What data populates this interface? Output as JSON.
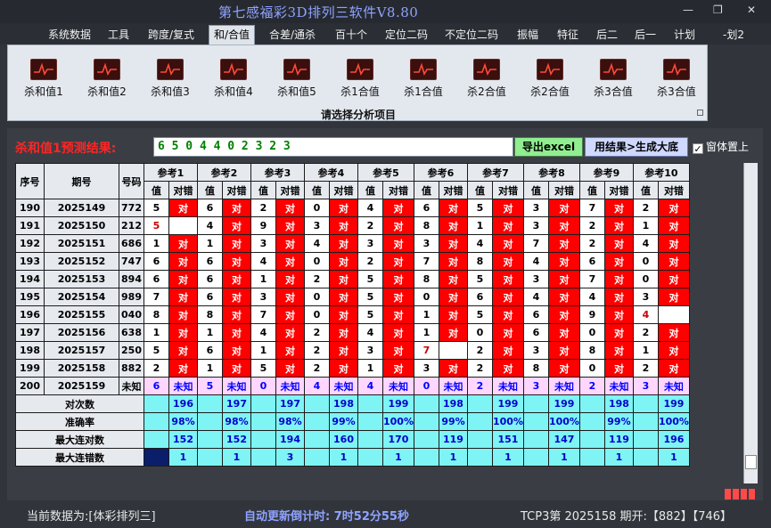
{
  "window": {
    "title": "第七感福彩3D排列三软件V8.80",
    "min_glyph": "—",
    "max_glyph": "❐",
    "close_glyph": "✕"
  },
  "menu": [
    "系统数据",
    "工具",
    "跨度/复式",
    "和/合值",
    "合差/通杀",
    "百十个",
    "定位二码",
    "不定位二码",
    "振幅",
    "特征",
    "后二",
    "后一",
    "计划",
    "-划2"
  ],
  "menu_active_index": 3,
  "toolbar": {
    "buttons": [
      "杀和值1",
      "杀和值2",
      "杀和值3",
      "杀和值4",
      "杀和值5",
      "杀1合值",
      "杀1合值",
      "杀2合值",
      "杀2合值",
      "杀3合值",
      "杀3合值"
    ],
    "group_caption": "请选择分析项目"
  },
  "result": {
    "label": "杀和值1预测结果:",
    "value": "6 5 0 4 4 0 2 3 2 3",
    "excel_button": "导出excel",
    "gen_button": "用结果>生成大底",
    "topmost_label": "窗体置上",
    "topmost_checked": "✓"
  },
  "table": {
    "headers": {
      "seq": "序号",
      "period": "期号",
      "code": "号码"
    },
    "refs": [
      "参考1",
      "参考2",
      "参考3",
      "参考4",
      "参考5",
      "参考6",
      "参考7",
      "参考8",
      "参考9",
      "参考10"
    ],
    "sub_value": "值",
    "sub_status": "对错",
    "ok_text": "对",
    "rows": [
      {
        "seq": "190",
        "period": "2025149",
        "code": "772",
        "vals": [
          "5",
          "6",
          "2",
          "0",
          "4",
          "6",
          "5",
          "3",
          "7",
          "2"
        ],
        "ok": [
          1,
          1,
          1,
          1,
          1,
          1,
          1,
          1,
          1,
          1
        ]
      },
      {
        "seq": "191",
        "period": "2025150",
        "code": "212",
        "vals": [
          "5",
          "4",
          "9",
          "3",
          "2",
          "8",
          "1",
          "3",
          "2",
          "1"
        ],
        "ok": [
          0,
          1,
          1,
          1,
          1,
          1,
          1,
          1,
          1,
          1
        ]
      },
      {
        "seq": "192",
        "period": "2025151",
        "code": "686",
        "vals": [
          "1",
          "1",
          "3",
          "4",
          "3",
          "3",
          "4",
          "7",
          "2",
          "4"
        ],
        "ok": [
          1,
          1,
          1,
          1,
          1,
          1,
          1,
          1,
          1,
          1
        ]
      },
      {
        "seq": "193",
        "period": "2025152",
        "code": "747",
        "vals": [
          "6",
          "6",
          "4",
          "0",
          "2",
          "7",
          "8",
          "4",
          "6",
          "0"
        ],
        "ok": [
          1,
          1,
          1,
          1,
          1,
          1,
          1,
          1,
          1,
          1
        ]
      },
      {
        "seq": "194",
        "period": "2025153",
        "code": "894",
        "vals": [
          "6",
          "6",
          "1",
          "2",
          "5",
          "8",
          "5",
          "3",
          "7",
          "0"
        ],
        "ok": [
          1,
          1,
          1,
          1,
          1,
          1,
          1,
          1,
          1,
          1
        ]
      },
      {
        "seq": "195",
        "period": "2025154",
        "code": "989",
        "vals": [
          "7",
          "6",
          "3",
          "0",
          "5",
          "0",
          "6",
          "4",
          "4",
          "3"
        ],
        "ok": [
          1,
          1,
          1,
          1,
          1,
          1,
          1,
          1,
          1,
          1
        ]
      },
      {
        "seq": "196",
        "period": "2025155",
        "code": "040",
        "vals": [
          "8",
          "8",
          "7",
          "0",
          "5",
          "1",
          "5",
          "6",
          "9",
          "4"
        ],
        "ok": [
          1,
          1,
          1,
          1,
          1,
          1,
          1,
          1,
          1,
          0
        ]
      },
      {
        "seq": "197",
        "period": "2025156",
        "code": "638",
        "vals": [
          "1",
          "1",
          "4",
          "2",
          "4",
          "1",
          "0",
          "6",
          "0",
          "2"
        ],
        "ok": [
          1,
          1,
          1,
          1,
          1,
          1,
          1,
          1,
          1,
          1
        ]
      },
      {
        "seq": "198",
        "period": "2025157",
        "code": "250",
        "vals": [
          "5",
          "6",
          "1",
          "2",
          "3",
          "7",
          "2",
          "3",
          "8",
          "1"
        ],
        "ok": [
          1,
          1,
          1,
          1,
          1,
          0,
          1,
          1,
          1,
          1
        ]
      },
      {
        "seq": "199",
        "period": "2025158",
        "code": "882",
        "vals": [
          "2",
          "1",
          "5",
          "2",
          "1",
          "3",
          "2",
          "8",
          "0",
          "2"
        ],
        "ok": [
          1,
          1,
          1,
          1,
          1,
          1,
          1,
          1,
          1,
          1
        ]
      }
    ],
    "bad_values": [
      [
        1,
        0
      ],
      [
        6,
        9
      ],
      [
        8,
        5
      ]
    ],
    "pred_row": {
      "seq": "200",
      "period": "2025159",
      "code": "未知",
      "vals": [
        "6",
        "5",
        "0",
        "4",
        "4",
        "0",
        "2",
        "3",
        "2",
        "3"
      ],
      "status": "未知"
    },
    "stats": [
      {
        "label": "对次数",
        "vals": [
          "196",
          "197",
          "197",
          "198",
          "199",
          "198",
          "199",
          "199",
          "198",
          "199"
        ]
      },
      {
        "label": "准确率",
        "vals": [
          "98%",
          "98%",
          "98%",
          "99%",
          "100%",
          "99%",
          "100%",
          "100%",
          "99%",
          "100%"
        ]
      },
      {
        "label": "最大连对数",
        "vals": [
          "152",
          "152",
          "194",
          "160",
          "170",
          "119",
          "151",
          "147",
          "119",
          "196"
        ]
      },
      {
        "label": "最大连错数",
        "vals": [
          "1",
          "1",
          "3",
          "1",
          "1",
          "1",
          "1",
          "1",
          "1",
          "1"
        ]
      }
    ]
  },
  "status": {
    "data_label": "当前数据为:[体彩排列三]",
    "countdown": "自动更新倒计时: 7时52分55秒",
    "latest": "TCP3第 2025158 期开:【882】【746】"
  }
}
